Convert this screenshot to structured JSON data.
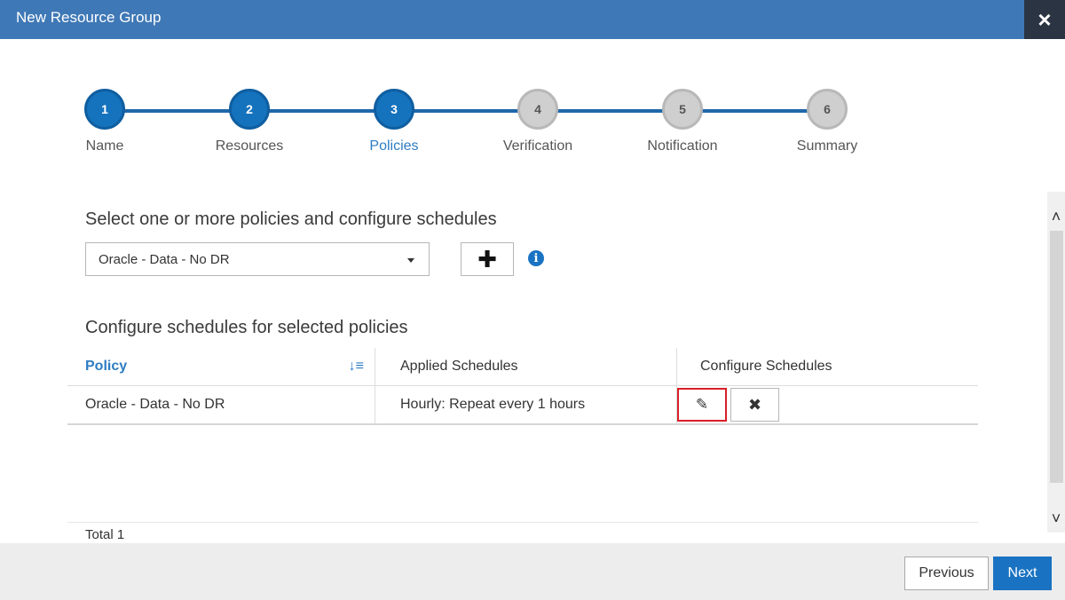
{
  "window": {
    "title": "New Resource Group",
    "close_icon": "×"
  },
  "wizard": {
    "steps": [
      {
        "number": "1",
        "label": "Name",
        "state": "completed"
      },
      {
        "number": "2",
        "label": "Resources",
        "state": "completed"
      },
      {
        "number": "3",
        "label": "Policies",
        "state": "current"
      },
      {
        "number": "4",
        "label": "Verification",
        "state": "pending"
      },
      {
        "number": "5",
        "label": "Notification",
        "state": "pending"
      },
      {
        "number": "6",
        "label": "Summary",
        "state": "pending"
      }
    ]
  },
  "policies": {
    "heading": "Select one or more policies and configure schedules",
    "selected_policy": "Oracle - Data - No DR",
    "add_icon": "✚",
    "info_icon": "i"
  },
  "schedules": {
    "heading": "Configure schedules for selected policies",
    "columns": [
      "Policy",
      "Applied Schedules",
      "Configure Schedules"
    ],
    "sort_icon": "↓≡",
    "rows": [
      {
        "policy": "Oracle - Data - No DR",
        "schedule": "Hourly: Repeat every 1 hours",
        "edit_icon": "✎",
        "delete_icon": "✖"
      }
    ],
    "total": "Total 1"
  },
  "scrollbar": {
    "up": "˄",
    "down": "˅"
  },
  "footer": {
    "previous_label": "Previous",
    "next_label": "Next"
  },
  "colors": {
    "title_bar": "#3f78b6",
    "accent": "#1a73c2",
    "highlight_border": "#d81e28"
  }
}
